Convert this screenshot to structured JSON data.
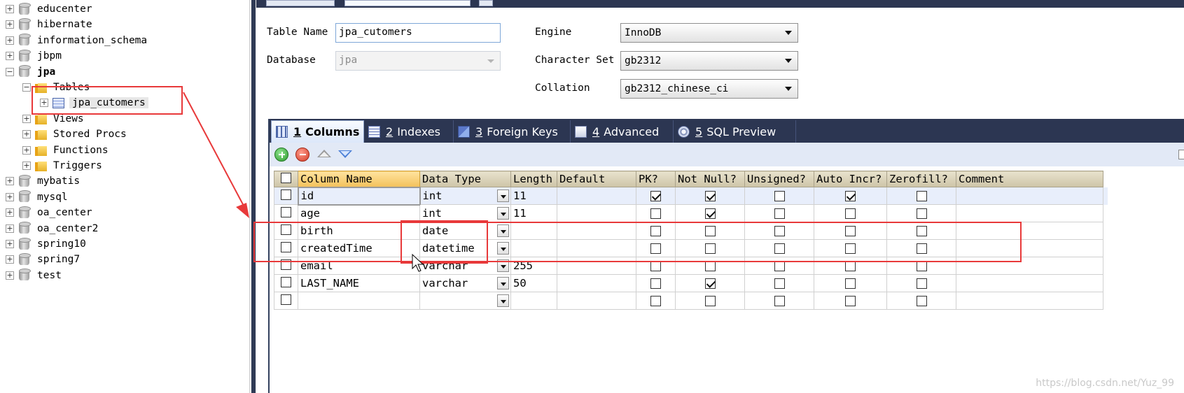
{
  "tree": {
    "databases": [
      {
        "label": "educenter",
        "expanded": false
      },
      {
        "label": "hibernate",
        "expanded": false
      },
      {
        "label": "information_schema",
        "expanded": false
      },
      {
        "label": "jbpm",
        "expanded": false
      },
      {
        "label": "jpa",
        "expanded": true
      },
      {
        "label": "mybatis",
        "expanded": false
      },
      {
        "label": "mysql",
        "expanded": false
      },
      {
        "label": "oa_center",
        "expanded": false
      },
      {
        "label": "oa_center2",
        "expanded": false
      },
      {
        "label": "spring10",
        "expanded": false
      },
      {
        "label": "spring7",
        "expanded": false
      },
      {
        "label": "test",
        "expanded": false
      }
    ],
    "jpa_children": {
      "tables": "Tables",
      "table_item": "jpa_cutomers",
      "views": "Views",
      "stored_procs": "Stored Procs",
      "functions": "Functions",
      "triggers": "Triggers"
    },
    "expand_symbol": "+",
    "collapse_symbol": "−"
  },
  "form": {
    "table_name_label": "Table Name",
    "table_name_value": "jpa_cutomers",
    "database_label": "Database",
    "database_value": "jpa",
    "engine_label": "Engine",
    "engine_value": "InnoDB",
    "charset_label": "Character Set",
    "charset_value": "gb2312",
    "collation_label": "Collation",
    "collation_value": "gb2312_chinese_ci"
  },
  "tabs": [
    {
      "num": "1",
      "label": "Columns",
      "icon": "columns-icon",
      "active": true
    },
    {
      "num": "2",
      "label": "Indexes",
      "icon": "indexes-icon",
      "active": false
    },
    {
      "num": "3",
      "label": "Foreign Keys",
      "icon": "foreign-keys-icon",
      "active": false
    },
    {
      "num": "4",
      "label": "Advanced",
      "icon": "advanced-icon",
      "active": false
    },
    {
      "num": "5",
      "label": "SQL Preview",
      "icon": "sql-preview-icon",
      "active": false
    }
  ],
  "grid": {
    "headers": [
      "Column Name",
      "Data Type",
      "Length",
      "Default",
      "PK?",
      "Not Null?",
      "Unsigned?",
      "Auto Incr?",
      "Zerofill?",
      "Comment"
    ],
    "rows": [
      {
        "name": "id",
        "type": "int",
        "length": "11",
        "default": "",
        "pk": true,
        "notnull": true,
        "unsigned": false,
        "autoincr": true,
        "zerofill": false,
        "comment": ""
      },
      {
        "name": "age",
        "type": "int",
        "length": "11",
        "default": "",
        "pk": false,
        "notnull": true,
        "unsigned": false,
        "autoincr": false,
        "zerofill": false,
        "comment": ""
      },
      {
        "name": "birth",
        "type": "date",
        "length": "",
        "default": "",
        "pk": false,
        "notnull": false,
        "unsigned": false,
        "autoincr": false,
        "zerofill": false,
        "comment": ""
      },
      {
        "name": "createdTime",
        "type": "datetime",
        "length": "",
        "default": "",
        "pk": false,
        "notnull": false,
        "unsigned": false,
        "autoincr": false,
        "zerofill": false,
        "comment": ""
      },
      {
        "name": "email",
        "type": "varchar",
        "length": "255",
        "default": "",
        "pk": false,
        "notnull": false,
        "unsigned": false,
        "autoincr": false,
        "zerofill": false,
        "comment": ""
      },
      {
        "name": "LAST_NAME",
        "type": "varchar",
        "length": "50",
        "default": "",
        "pk": false,
        "notnull": true,
        "unsigned": false,
        "autoincr": false,
        "zerofill": false,
        "comment": ""
      },
      {
        "name": "",
        "type": "",
        "length": "",
        "default": "",
        "pk": false,
        "notnull": false,
        "unsigned": false,
        "autoincr": false,
        "zerofill": false,
        "comment": ""
      }
    ]
  },
  "watermark": "https://blog.csdn.net/Yuz_99",
  "colors": {
    "annotation": "#e8393a",
    "tab_strip": "#2c3652",
    "toolbar": "#e2e9f6",
    "header": "#cdc4a7"
  }
}
